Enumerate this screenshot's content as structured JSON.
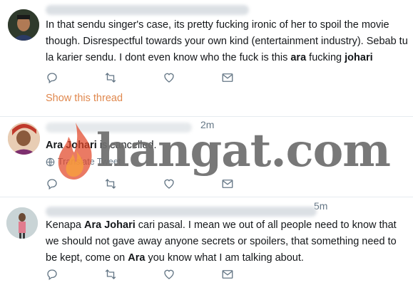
{
  "tweets": [
    {
      "time": "",
      "text_html": "In that sendu singer's case, its pretty fucking ironic of her to spoil the movie though. Disrespectful towards your own kind (entertainment industry). Sebab tu la karier sendu. I dont even know who the fuck is this <b>ara</b> fucking <b>johari</b>",
      "show_thread": "Show this thread"
    },
    {
      "time": "2m",
      "text_html": "<b>Ara Johari</b> is cancelled.",
      "translate": "Translate Tweet"
    },
    {
      "time": "5m",
      "text_html": "Kenapa <b>Ara Johari</b> cari pasal. I mean we out of all people need to know that we should not gave away anyone secrets or spoilers, that something need to be kept, come on <b>Ara</b> you know what I am talking about."
    }
  ],
  "watermark": {
    "text": "hangat.com"
  },
  "icons": {
    "reply": "reply-icon",
    "retweet": "retweet-icon",
    "like": "heart-icon",
    "dm": "envelope-icon",
    "globe": "globe-icon",
    "flame": "flame-icon"
  },
  "colors": {
    "link": "#e0884e",
    "muted": "#657786",
    "text": "#14171a"
  }
}
